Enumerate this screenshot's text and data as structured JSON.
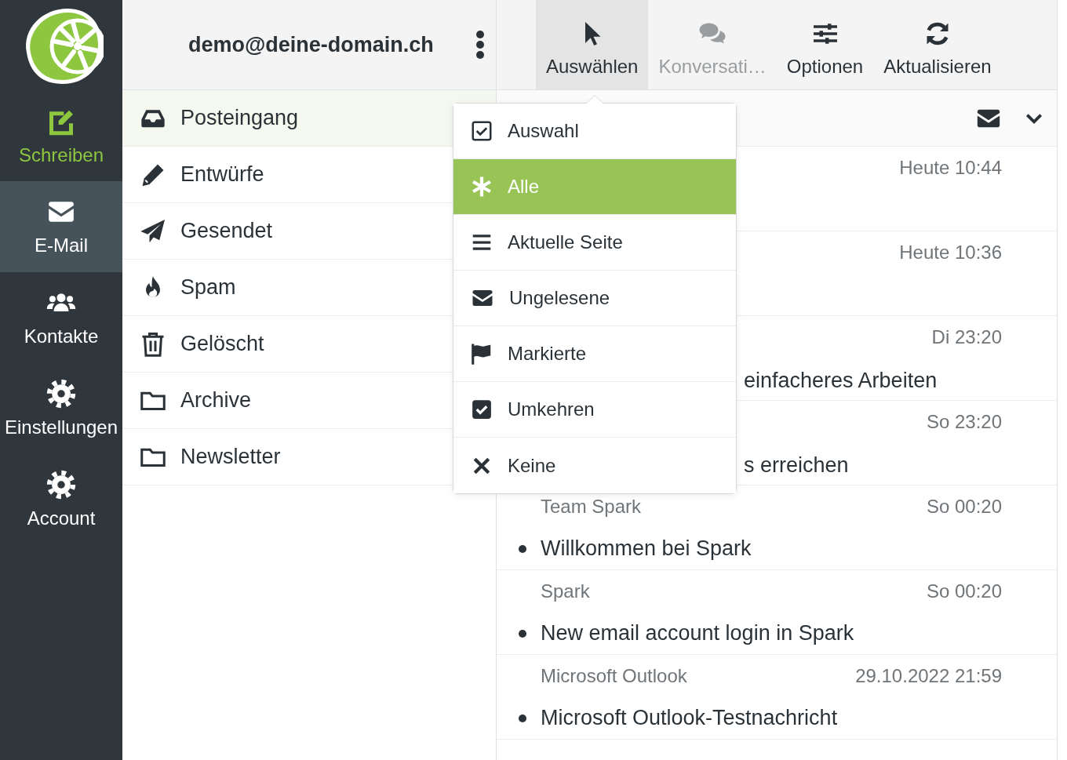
{
  "nav": {
    "items": [
      {
        "label": "Schreiben",
        "kind": "action",
        "selected": false
      },
      {
        "label": "E-Mail",
        "kind": "section",
        "selected": true
      },
      {
        "label": "Kontakte",
        "kind": "section",
        "selected": false
      },
      {
        "label": "Einstellungen",
        "kind": "section",
        "selected": false
      },
      {
        "label": "Account",
        "kind": "section",
        "selected": false
      }
    ]
  },
  "account": {
    "email": "demo@deine-domain.ch"
  },
  "folders": [
    {
      "label": "Posteingang",
      "selected": true
    },
    {
      "label": "Entwürfe",
      "selected": false
    },
    {
      "label": "Gesendet",
      "selected": false
    },
    {
      "label": "Spam",
      "selected": false
    },
    {
      "label": "Gelöscht",
      "selected": false
    },
    {
      "label": "Archive",
      "selected": false
    },
    {
      "label": "Newsletter",
      "selected": false
    }
  ],
  "toolbar": [
    {
      "label": "Auswählen",
      "selected": true,
      "disabled": false
    },
    {
      "label": "Konversati…",
      "selected": false,
      "disabled": true
    },
    {
      "label": "Optionen",
      "selected": false,
      "disabled": false
    },
    {
      "label": "Aktualisieren",
      "selected": false,
      "disabled": false
    }
  ],
  "messages": [
    {
      "kind": "covered",
      "date": "Heute 10:44"
    },
    {
      "kind": "covered",
      "date": "Heute 10:36"
    },
    {
      "kind": "covered",
      "date": "Di 23:20",
      "subject": "einfacheres Arbeiten"
    },
    {
      "kind": "covered",
      "date": "So 23:20",
      "subject": "s erreichen"
    },
    {
      "kind": "full",
      "sender": "Team Spark",
      "date": "So 00:20",
      "subject": "Willkommen bei Spark",
      "unread": true
    },
    {
      "kind": "full",
      "sender": "Spark",
      "date": "So 00:20",
      "subject": "New email account login in Spark",
      "unread": true
    },
    {
      "kind": "full",
      "sender": "Microsoft Outlook",
      "date": "29.10.2022 21:59",
      "subject": "Microsoft Outlook-Testnachricht",
      "unread": true
    }
  ],
  "select_menu": {
    "items": [
      {
        "label": "Auswahl",
        "selected": false
      },
      {
        "label": "Alle",
        "selected": true
      },
      {
        "label": "Aktuelle Seite",
        "selected": false
      },
      {
        "label": "Ungelesene",
        "selected": false
      },
      {
        "label": "Markierte",
        "selected": false
      },
      {
        "label": "Umkehren",
        "selected": false
      },
      {
        "label": "Keine",
        "selected": false
      }
    ]
  }
}
